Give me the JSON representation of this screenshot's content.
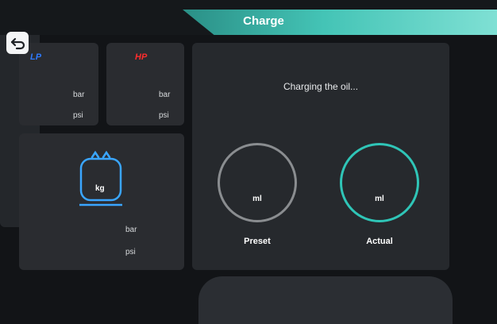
{
  "header": {
    "title": "Charge"
  },
  "gauges": {
    "lp": {
      "tag": "LP",
      "unit_bar": "bar",
      "unit_psi": "psi",
      "color": "#2e7bff"
    },
    "hp": {
      "tag": "HP",
      "unit_bar": "bar",
      "unit_psi": "psi",
      "color": "#ff2d2d"
    }
  },
  "tank": {
    "unit_kg": "kg",
    "unit_bar": "bar",
    "unit_psi": "psi",
    "icon": "refrigerant-tank-icon"
  },
  "main": {
    "status": "Charging the oil...",
    "preset": {
      "label": "Preset",
      "unit": "ml"
    },
    "actual": {
      "label": "Actual",
      "unit": "ml"
    }
  },
  "side": {
    "back_icon": "return-arrow-icon"
  },
  "colors": {
    "accent": "#2fc5b7",
    "background": "#121417",
    "panel": "#2a2c30"
  }
}
